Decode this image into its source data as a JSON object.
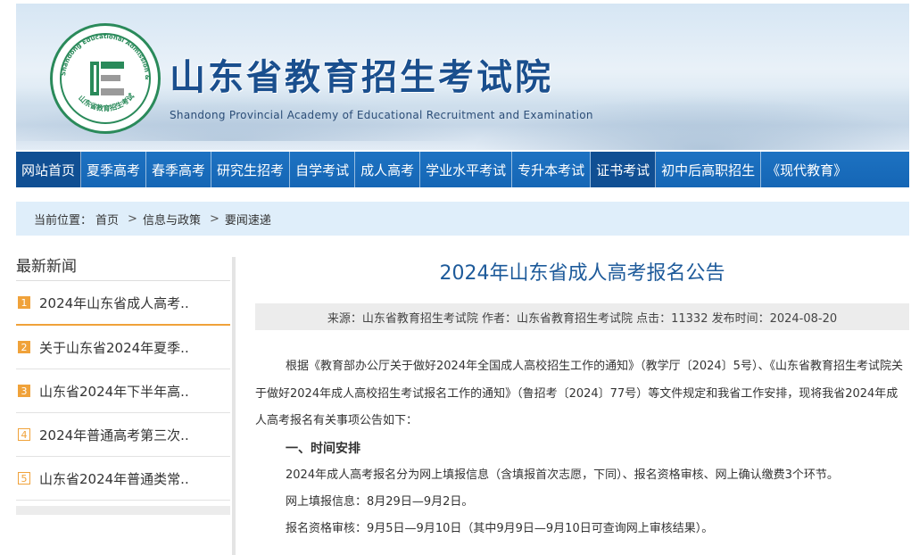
{
  "header": {
    "title": "山东省教育招生考试院",
    "subtitle": "Shandong Provincial Academy of Educational Recruitment and Examination",
    "logo_ring_text": "Shandong Educational Admission & Examinations",
    "logo_cn_text": "山东省教育招生考试"
  },
  "nav": {
    "items": [
      {
        "label": "网站首页"
      },
      {
        "label": "夏季高考"
      },
      {
        "label": "春季高考"
      },
      {
        "label": "研究生招考"
      },
      {
        "label": "自学考试"
      },
      {
        "label": "成人高考"
      },
      {
        "label": "学业水平考试"
      },
      {
        "label": "专升本考试"
      },
      {
        "label": "证书考试"
      },
      {
        "label": "初中后高职招生"
      },
      {
        "label": "《现代教育》"
      }
    ]
  },
  "breadcrumb": {
    "prefix": "当前位置：",
    "items": [
      "首页",
      "信息与政策",
      "要闻速递"
    ],
    "separator": ">"
  },
  "sidebar": {
    "title": "最新新闻",
    "items": [
      {
        "num": "1",
        "label": "2024年山东省成人高考.."
      },
      {
        "num": "2",
        "label": "关于山东省2024年夏季.."
      },
      {
        "num": "3",
        "label": "山东省2024年下半年高.."
      },
      {
        "num": "4",
        "label": "2024年普通高考第三次.."
      },
      {
        "num": "5",
        "label": "山东省2024年普通类常.."
      }
    ]
  },
  "article": {
    "title": "2024年山东省成人高考报名公告",
    "meta": "来源：山东省教育招生考试院 作者：山东省教育招生考试院 点击：11332 发布时间：2024-08-20",
    "paragraph": "根据《教育部办公厅关于做好2024年全国成人高校招生工作的通知》（教学厅〔2024〕5号）、《山东省教育招生考试院关于做好2024年成人高校招生考试报名工作的通知》（鲁招考〔2024〕77号）等文件规定和我省工作安排，现将我省2024年成人高考报名有关事项公告如下：",
    "heading1": "一、时间安排",
    "line1": "2024年成人高考报名分为网上填报信息（含填报首次志愿，下同）、报名资格审核、网上确认缴费3个环节。",
    "line2": "网上填报信息：8月29日—9月2日。",
    "line3": "报名资格审核：9月5日—9月10日（其中9月9日—9月10日可查询网上审核结果）。"
  },
  "colors": {
    "nav_bg": "#1566b5",
    "nav_active": "#104f93",
    "title_blue": "#1d5a9a",
    "accent_orange": "#f0a23a",
    "logo_green": "#2a8a5a"
  }
}
